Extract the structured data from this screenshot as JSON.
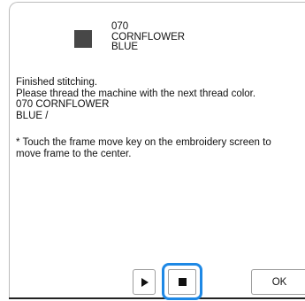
{
  "thread": {
    "number": "070",
    "name_line1": "CORNFLOWER",
    "name_line2": "BLUE",
    "swatch_color": "#474747"
  },
  "message": {
    "line1": "Finished stitching.",
    "line2": "Please thread the machine with the next thread color.",
    "next_color_line1": "070 CORNFLOWER",
    "next_color_line2": "BLUE /",
    "note_line1": "* Touch the frame move key on the embroidery screen to",
    "note_line2": "move frame to the center."
  },
  "buttons": {
    "play_icon": "play-icon",
    "stop_icon": "stop-icon",
    "ok_label": "OK",
    "highlight_color": "#1e88e5"
  }
}
